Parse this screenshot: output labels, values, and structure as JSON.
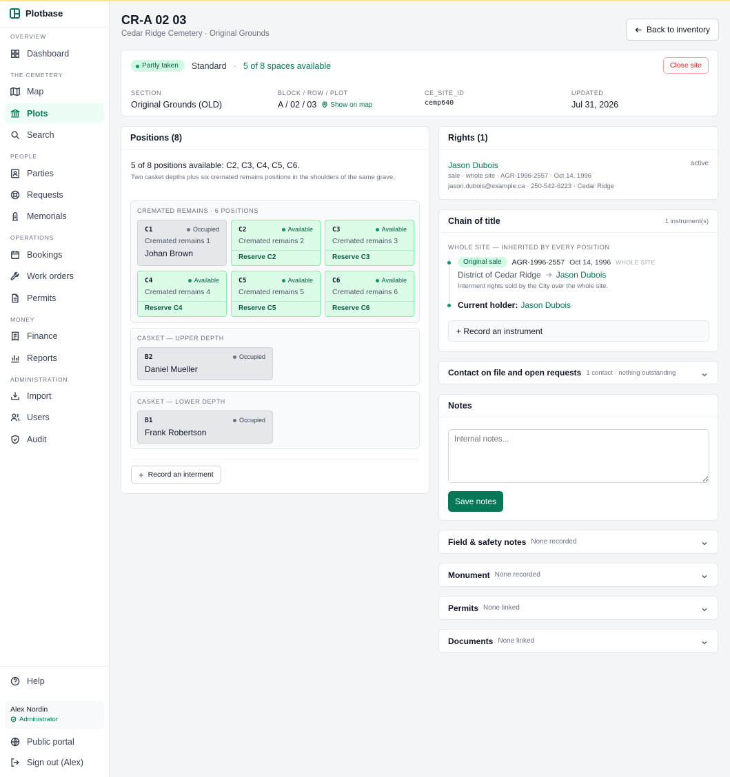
{
  "app": {
    "name": "Plotbase"
  },
  "nav": {
    "sections": {
      "overview": "OVERVIEW",
      "cemetery": "THE CEMETERY",
      "people": "PEOPLE",
      "operations": "OPERATIONS",
      "money": "MONEY",
      "administration": "ADMINISTRATION"
    },
    "items": {
      "dashboard": "Dashboard",
      "map": "Map",
      "plots": "Plots",
      "search": "Search",
      "parties": "Parties",
      "requests": "Requests",
      "memorials": "Memorials",
      "bookings": "Bookings",
      "work_orders": "Work orders",
      "permits": "Permits",
      "finance": "Finance",
      "reports": "Reports",
      "import": "Import",
      "users": "Users",
      "audit": "Audit"
    },
    "help": "Help",
    "user": {
      "name": "Alex Nordin",
      "role": "Administrator"
    },
    "public_portal": "Public portal",
    "sign_out": "Sign out (Alex)"
  },
  "page": {
    "title": "CR-A 02 03",
    "subtitle": "Cedar Ridge Cemetery · Original Grounds",
    "back_button": "Back to inventory"
  },
  "summary": {
    "status_pill": "Partly taken",
    "type": "Standard",
    "availability": "5 of 8 spaces available",
    "close_button": "Close site",
    "section_label": "SECTION",
    "section_value": "Original Grounds (OLD)",
    "block_label": "BLOCK / ROW / PLOT",
    "block_value": "A / 02 / 03",
    "show_on_map": "Show on map",
    "site_id_label": "CE_SITE_ID",
    "site_id_value": "cemp640",
    "updated_label": "UPDATED",
    "updated_value": "Jul 31, 2026"
  },
  "positions": {
    "header": "Positions (8)",
    "summary": "5 of 8 positions available: C2, C3, C4, C5, C6.",
    "description": "Two casket depths plus six cremated remains positions in the shoulders of the same grave.",
    "cremated": {
      "title": "CREMATED REMAINS · 6 POSITIONS",
      "slots": [
        {
          "code": "C1",
          "status": "Occupied",
          "desc": "Cremated remains 1",
          "name": "Johan Brown"
        },
        {
          "code": "C2",
          "status": "Available",
          "desc": "Cremated remains 2",
          "action": "Reserve C2"
        },
        {
          "code": "C3",
          "status": "Available",
          "desc": "Cremated remains 3",
          "action": "Reserve C3"
        },
        {
          "code": "C4",
          "status": "Available",
          "desc": "Cremated remains 4",
          "action": "Reserve C4"
        },
        {
          "code": "C5",
          "status": "Available",
          "desc": "Cremated remains 5",
          "action": "Reserve C5"
        },
        {
          "code": "C6",
          "status": "Available",
          "desc": "Cremated remains 6",
          "action": "Reserve C6"
        }
      ]
    },
    "upper": {
      "title": "CASKET — UPPER DEPTH",
      "slot": {
        "code": "B2",
        "status": "Occupied",
        "name": "Daniel Mueller"
      }
    },
    "lower": {
      "title": "CASKET — LOWER DEPTH",
      "slot": {
        "code": "B1",
        "status": "Occupied",
        "name": "Frank Robertson"
      }
    },
    "record_button": "Record an interment"
  },
  "rights": {
    "header": "Rights (1)",
    "holder": "Jason Dubois",
    "state": "active",
    "line1": "sale · whole site · AGR-1996-2557 · Oct 14, 1996",
    "line2": "jason.dubois@example.ca · 250-542-6223 · Cedar Ridge"
  },
  "chain": {
    "header": "Chain of title",
    "count": "1 instrument(s)",
    "scope_title": "WHOLE SITE — INHERITED BY EVERY POSITION",
    "instrument_pill": "Original sale",
    "instrument_ref": "AGR-1996-2557",
    "instrument_date": "Oct 14, 1996",
    "instrument_scope": "WHOLE SITE",
    "from": "District of Cedar Ridge",
    "to": "Jason Dubois",
    "note": "Interment rights sold by the City over the whole site.",
    "current_label": "Current holder:",
    "current_holder": "Jason Dubois",
    "record_button": "+ Record an instrument"
  },
  "contact": {
    "title": "Contact on file and open requests",
    "sub": "1 contact · nothing outstanding"
  },
  "notes": {
    "header": "Notes",
    "placeholder": "Internal notes...",
    "save_button": "Save notes"
  },
  "collapsibles": {
    "field": {
      "title": "Field & safety notes",
      "sub": "None recorded"
    },
    "monument": {
      "title": "Monument",
      "sub": "None recorded"
    },
    "permits": {
      "title": "Permits",
      "sub": "None linked"
    },
    "documents": {
      "title": "Documents",
      "sub": "None linked"
    }
  },
  "colors": {
    "accent": "#047857",
    "available_bg": "#dcfce7",
    "occupied_bg": "#e5e7eb",
    "danger": "#dc2626"
  }
}
